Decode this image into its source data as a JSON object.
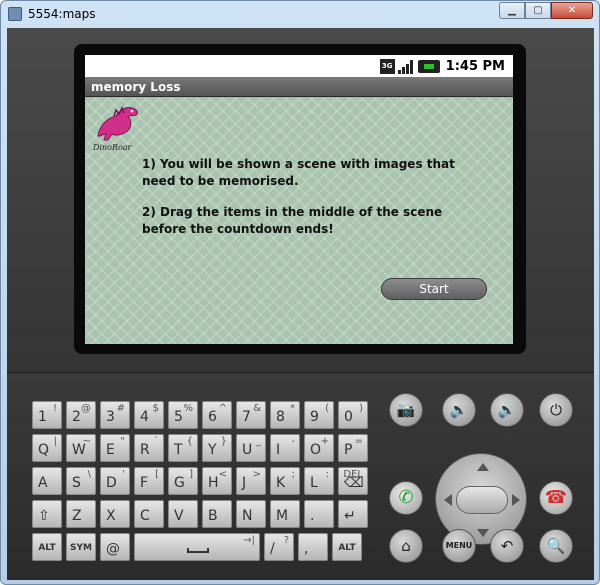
{
  "window": {
    "title": "5554:maps"
  },
  "statusbar": {
    "network": "3G",
    "time": "1:45 PM"
  },
  "app": {
    "title": "memory Loss",
    "logo_text": "DinoRoar",
    "instructions": [
      "1) You will be shown a scene with images that need to be memorised.",
      "2) Drag the items in the middle of the scene before the countdown ends!"
    ],
    "start_label": "Start"
  },
  "keyboard": {
    "rows": [
      [
        {
          "m": "1",
          "a": "!"
        },
        {
          "m": "2",
          "a": "@"
        },
        {
          "m": "3",
          "a": "#"
        },
        {
          "m": "4",
          "a": "$"
        },
        {
          "m": "5",
          "a": "%"
        },
        {
          "m": "6",
          "a": "^"
        },
        {
          "m": "7",
          "a": "&"
        },
        {
          "m": "8",
          "a": "*"
        },
        {
          "m": "9",
          "a": "("
        },
        {
          "m": "0",
          "a": ")"
        }
      ],
      [
        {
          "m": "Q",
          "a": "|"
        },
        {
          "m": "W",
          "a": "~"
        },
        {
          "m": "E",
          "a": "\""
        },
        {
          "m": "R",
          "a": "`"
        },
        {
          "m": "T",
          "a": "{"
        },
        {
          "m": "Y",
          "a": "}"
        },
        {
          "m": "U",
          "a": "_"
        },
        {
          "m": "I",
          "a": "-"
        },
        {
          "m": "O",
          "a": "+"
        },
        {
          "m": "P",
          "a": "="
        }
      ],
      [
        {
          "m": "A",
          "a": ""
        },
        {
          "m": "S",
          "a": "\\"
        },
        {
          "m": "D",
          "a": "'"
        },
        {
          "m": "F",
          "a": "["
        },
        {
          "m": "G",
          "a": "]"
        },
        {
          "m": "H",
          "a": "<"
        },
        {
          "m": "J",
          "a": ">"
        },
        {
          "m": "K",
          "a": ";"
        },
        {
          "m": "L",
          "a": ":"
        },
        {
          "m": "⌫",
          "a": "DEL"
        }
      ],
      [
        {
          "m": "⇧",
          "a": ""
        },
        {
          "m": "Z",
          "a": ""
        },
        {
          "m": "X",
          "a": ""
        },
        {
          "m": "C",
          "a": ""
        },
        {
          "m": "V",
          "a": ""
        },
        {
          "m": "B",
          "a": ""
        },
        {
          "m": "N",
          "a": ""
        },
        {
          "m": "M",
          "a": ""
        },
        {
          "m": ".",
          "a": ""
        },
        {
          "m": "↵",
          "a": ""
        }
      ]
    ],
    "bottom": {
      "alt_left": "ALT",
      "sym": "SYM",
      "at": "@",
      "tab": "→|",
      "slash": "/",
      "question": "?",
      "comma": ",",
      "alt_right": "ALT"
    }
  },
  "buttons": {
    "camera_icon": "camera-icon",
    "vol_down_icon": "volume-down-icon",
    "vol_up_icon": "volume-up-icon",
    "power_icon": "power-icon",
    "call_icon": "call-icon",
    "end_call_icon": "end-call-icon",
    "home_icon": "home-icon",
    "menu_label": "MENU",
    "back_icon": "back-icon",
    "search_icon": "search-icon"
  },
  "colors": {
    "call": "#2a9d3c",
    "end_call": "#d0312d",
    "screen_bg": "#a9c3af"
  }
}
